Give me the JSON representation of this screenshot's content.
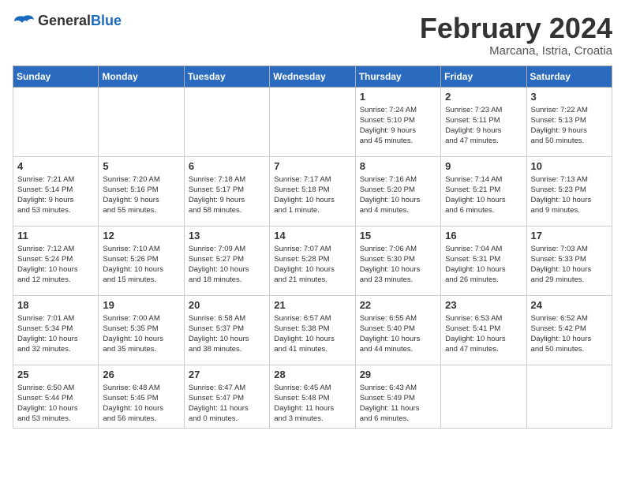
{
  "header": {
    "logo_general": "General",
    "logo_blue": "Blue",
    "title": "February 2024",
    "subtitle": "Marcana, Istria, Croatia"
  },
  "weekdays": [
    "Sunday",
    "Monday",
    "Tuesday",
    "Wednesday",
    "Thursday",
    "Friday",
    "Saturday"
  ],
  "weeks": [
    [
      {
        "day": "",
        "info": ""
      },
      {
        "day": "",
        "info": ""
      },
      {
        "day": "",
        "info": ""
      },
      {
        "day": "",
        "info": ""
      },
      {
        "day": "1",
        "info": "Sunrise: 7:24 AM\nSunset: 5:10 PM\nDaylight: 9 hours\nand 45 minutes."
      },
      {
        "day": "2",
        "info": "Sunrise: 7:23 AM\nSunset: 5:11 PM\nDaylight: 9 hours\nand 47 minutes."
      },
      {
        "day": "3",
        "info": "Sunrise: 7:22 AM\nSunset: 5:13 PM\nDaylight: 9 hours\nand 50 minutes."
      }
    ],
    [
      {
        "day": "4",
        "info": "Sunrise: 7:21 AM\nSunset: 5:14 PM\nDaylight: 9 hours\nand 53 minutes."
      },
      {
        "day": "5",
        "info": "Sunrise: 7:20 AM\nSunset: 5:16 PM\nDaylight: 9 hours\nand 55 minutes."
      },
      {
        "day": "6",
        "info": "Sunrise: 7:18 AM\nSunset: 5:17 PM\nDaylight: 9 hours\nand 58 minutes."
      },
      {
        "day": "7",
        "info": "Sunrise: 7:17 AM\nSunset: 5:18 PM\nDaylight: 10 hours\nand 1 minute."
      },
      {
        "day": "8",
        "info": "Sunrise: 7:16 AM\nSunset: 5:20 PM\nDaylight: 10 hours\nand 4 minutes."
      },
      {
        "day": "9",
        "info": "Sunrise: 7:14 AM\nSunset: 5:21 PM\nDaylight: 10 hours\nand 6 minutes."
      },
      {
        "day": "10",
        "info": "Sunrise: 7:13 AM\nSunset: 5:23 PM\nDaylight: 10 hours\nand 9 minutes."
      }
    ],
    [
      {
        "day": "11",
        "info": "Sunrise: 7:12 AM\nSunset: 5:24 PM\nDaylight: 10 hours\nand 12 minutes."
      },
      {
        "day": "12",
        "info": "Sunrise: 7:10 AM\nSunset: 5:26 PM\nDaylight: 10 hours\nand 15 minutes."
      },
      {
        "day": "13",
        "info": "Sunrise: 7:09 AM\nSunset: 5:27 PM\nDaylight: 10 hours\nand 18 minutes."
      },
      {
        "day": "14",
        "info": "Sunrise: 7:07 AM\nSunset: 5:28 PM\nDaylight: 10 hours\nand 21 minutes."
      },
      {
        "day": "15",
        "info": "Sunrise: 7:06 AM\nSunset: 5:30 PM\nDaylight: 10 hours\nand 23 minutes."
      },
      {
        "day": "16",
        "info": "Sunrise: 7:04 AM\nSunset: 5:31 PM\nDaylight: 10 hours\nand 26 minutes."
      },
      {
        "day": "17",
        "info": "Sunrise: 7:03 AM\nSunset: 5:33 PM\nDaylight: 10 hours\nand 29 minutes."
      }
    ],
    [
      {
        "day": "18",
        "info": "Sunrise: 7:01 AM\nSunset: 5:34 PM\nDaylight: 10 hours\nand 32 minutes."
      },
      {
        "day": "19",
        "info": "Sunrise: 7:00 AM\nSunset: 5:35 PM\nDaylight: 10 hours\nand 35 minutes."
      },
      {
        "day": "20",
        "info": "Sunrise: 6:58 AM\nSunset: 5:37 PM\nDaylight: 10 hours\nand 38 minutes."
      },
      {
        "day": "21",
        "info": "Sunrise: 6:57 AM\nSunset: 5:38 PM\nDaylight: 10 hours\nand 41 minutes."
      },
      {
        "day": "22",
        "info": "Sunrise: 6:55 AM\nSunset: 5:40 PM\nDaylight: 10 hours\nand 44 minutes."
      },
      {
        "day": "23",
        "info": "Sunrise: 6:53 AM\nSunset: 5:41 PM\nDaylight: 10 hours\nand 47 minutes."
      },
      {
        "day": "24",
        "info": "Sunrise: 6:52 AM\nSunset: 5:42 PM\nDaylight: 10 hours\nand 50 minutes."
      }
    ],
    [
      {
        "day": "25",
        "info": "Sunrise: 6:50 AM\nSunset: 5:44 PM\nDaylight: 10 hours\nand 53 minutes."
      },
      {
        "day": "26",
        "info": "Sunrise: 6:48 AM\nSunset: 5:45 PM\nDaylight: 10 hours\nand 56 minutes."
      },
      {
        "day": "27",
        "info": "Sunrise: 6:47 AM\nSunset: 5:47 PM\nDaylight: 11 hours\nand 0 minutes."
      },
      {
        "day": "28",
        "info": "Sunrise: 6:45 AM\nSunset: 5:48 PM\nDaylight: 11 hours\nand 3 minutes."
      },
      {
        "day": "29",
        "info": "Sunrise: 6:43 AM\nSunset: 5:49 PM\nDaylight: 11 hours\nand 6 minutes."
      },
      {
        "day": "",
        "info": ""
      },
      {
        "day": "",
        "info": ""
      }
    ]
  ]
}
